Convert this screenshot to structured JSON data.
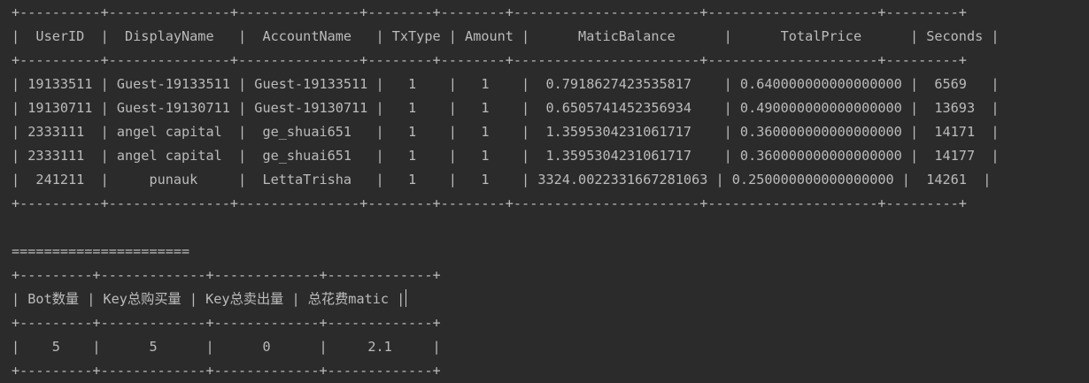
{
  "terminal": {
    "lines": [
      "+----------+---------------+---------------+--------+--------+-----------------------+---------------------+---------+",
      "|  UserID  |  DisplayName   |  AccountName   | TxType | Amount |      MaticBalance      |      TotalPrice      | Seconds |",
      "+----------+---------------+---------------+--------+--------+-----------------------+---------------------+---------+",
      "| 19133511 | Guest-19133511 | Guest-19133511 |   1    |   1    |  0.7918627423535817    | 0.640000000000000000 |  6569   |",
      "| 19130711 | Guest-19130711 | Guest-19130711 |   1    |   1    |  0.6505741452356934    | 0.490000000000000000 |  13693  |",
      "| 2333111  | angel capital  |  ge_shuai651   |   1    |   1    |  1.3595304231061717    | 0.360000000000000000 |  14171  |",
      "| 2333111  | angel capital  |  ge_shuai651   |   1    |   1    |  1.3595304231061717    | 0.360000000000000000 |  14177  |",
      "|  241211  |     punauk     |  LettaTrisha   |   1    |   1    | 3324.0022331667281063 | 0.250000000000000000 |  14261  |",
      "+----------+---------------+---------------+--------+--------+-----------------------+---------------------+---------+",
      "",
      "======================",
      "+---------+-------------+-------------+-------------+",
      "| Bot数量 | Key总购买量 | Key总卖出量 | 总花费matic |",
      "+---------+-------------+-------------+-------------+",
      "|    5    |      5      |      0      |     2.1     |",
      "+---------+-------------+-------------+-------------+"
    ]
  }
}
